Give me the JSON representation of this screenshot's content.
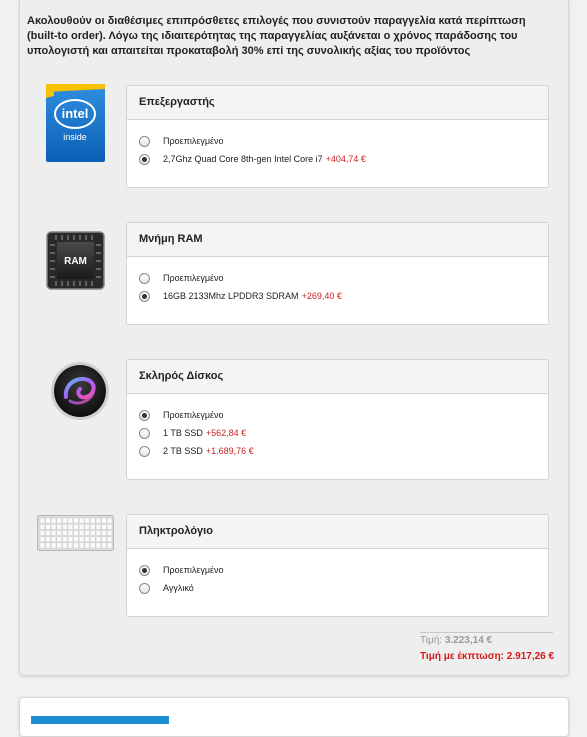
{
  "intro_text": "Ακολουθούν οι διαθέσιμες επιπρόσθετες επιλογές που συνιστούν παραγγελία κατά περίπτωση (built-to order). Λόγω της ιδιαιτερότητας της παραγγελίας αυξάνεται ο χρόνος παράδοσης του υπολογιστή και απαιτείται προκαταβολή 30% επί της συνολικής αξίας του προϊόντος",
  "groups": [
    {
      "title": "Επεξεργαστής",
      "icon": "intel-inside-icon",
      "icon_text": [
        "intel",
        "inside"
      ],
      "options": [
        {
          "label": "Προεπιλεγμένο",
          "price": "",
          "selected": false
        },
        {
          "label": "2,7Ghz Quad Core 8th-gen Intel Core i7",
          "price": "+404,74 €",
          "selected": true
        }
      ]
    },
    {
      "title": "Μνήμη RAM",
      "icon": "ram-chip-icon",
      "icon_text": [
        "RAM"
      ],
      "options": [
        {
          "label": "Προεπιλεγμένο",
          "price": "",
          "selected": false
        },
        {
          "label": "16GB 2133Mhz LPDDR3 SDRAM",
          "price": "+269,40 €",
          "selected": true
        }
      ]
    },
    {
      "title": "Σκληρός Δίσκος",
      "icon": "fusion-drive-icon",
      "options": [
        {
          "label": "Προεπιλεγμένο",
          "price": "",
          "selected": true
        },
        {
          "label": "1 TB SSD",
          "price": "+562,84 €",
          "selected": false
        },
        {
          "label": "2 TB SSD",
          "price": "+1.689,76 €",
          "selected": false
        }
      ]
    },
    {
      "title": "Πληκτρολόγιο",
      "icon": "keyboard-icon",
      "options": [
        {
          "label": "Προεπιλεγμένο",
          "price": "",
          "selected": true
        },
        {
          "label": "Αγγλικό",
          "price": "",
          "selected": false
        }
      ]
    }
  ],
  "totals": {
    "price_label": "Τιμή:",
    "price_value": "3.223,14 €",
    "discount_label": "Τιμή με έκπτωση:",
    "discount_value": "2.917,26 €"
  },
  "colors": {
    "accent_red": "#d21a1a",
    "price_red": "#cc2222",
    "blue": "#1e8fd6"
  }
}
